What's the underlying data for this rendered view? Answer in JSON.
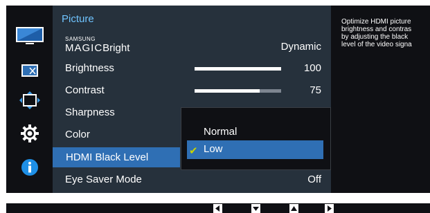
{
  "menu": {
    "title": "Picture",
    "magic_bright": {
      "samsung": "SAMSUNG",
      "magic": "MAGIC",
      "label": "Bright",
      "value": "Dynamic"
    },
    "items": [
      {
        "label": "Brightness",
        "value": "100",
        "level": 100
      },
      {
        "label": "Contrast",
        "value": "75",
        "level": 75
      },
      {
        "label": "Sharpness"
      },
      {
        "label": "Color"
      },
      {
        "label": "HDMI Black Level"
      },
      {
        "label": "Eye Saver Mode",
        "value": "Off"
      }
    ]
  },
  "dropdown": {
    "options": [
      {
        "label": "Normal",
        "selected": false
      },
      {
        "label": "Low",
        "selected": true
      }
    ]
  },
  "description": [
    "Optimize HDMI picture",
    "brightness and contras",
    "by adjusting the black",
    "level of the video signa"
  ],
  "colors": {
    "accent": "#2f6fb4",
    "title": "#6fc4ff",
    "check": "#c8d400",
    "panel": "#26313c",
    "background": "#0f1014"
  },
  "icons": {
    "nav": [
      "picture-icon",
      "picture-size-icon",
      "position-icon",
      "settings-gear-icon",
      "information-icon"
    ],
    "keys": [
      "left-arrow-key-icon",
      "down-arrow-key-icon",
      "up-arrow-key-icon",
      "right-arrow-key-icon"
    ]
  }
}
